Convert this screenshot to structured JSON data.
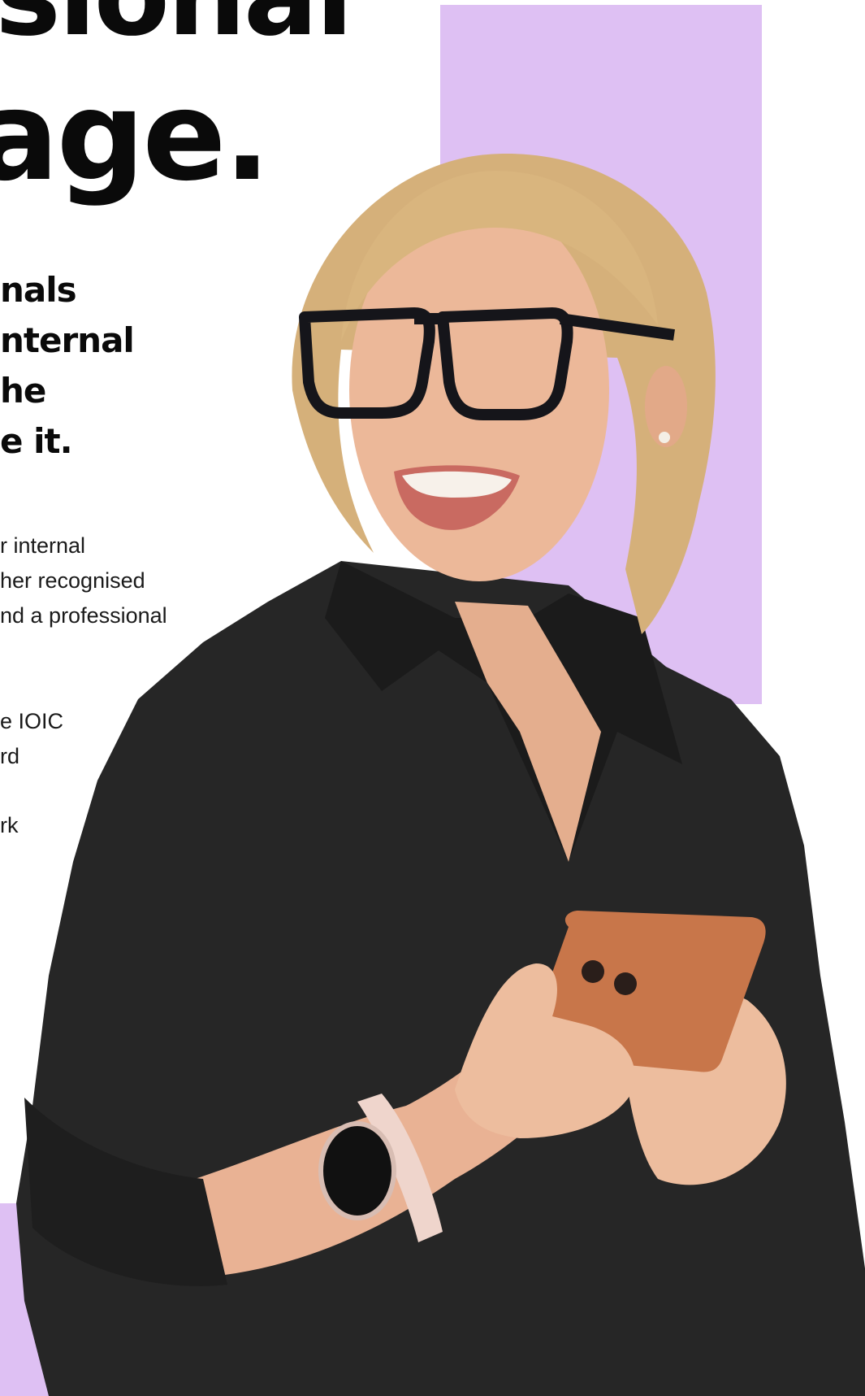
{
  "brand": {
    "accent": "#dec0f3",
    "text": "#0a0a0a",
    "skin": "#e9b89a",
    "shirt": "#262626",
    "phone": "#c8764a",
    "watch_band": "#efd5cc"
  },
  "hero": {
    "headline_line1": "sional",
    "headline_line2": "age.",
    "subhead_lines": [
      "nals",
      "nternal",
      "he",
      "e it."
    ],
    "paragraph1_lines": [
      "r internal",
      "her recognised",
      "nd a professional"
    ],
    "paragraph2_lines": [
      "e IOIC",
      "rd"
    ],
    "paragraph3_lines": [
      "rk"
    ]
  },
  "icons": {
    "photo": "smiling-woman-with-phone-photo"
  }
}
